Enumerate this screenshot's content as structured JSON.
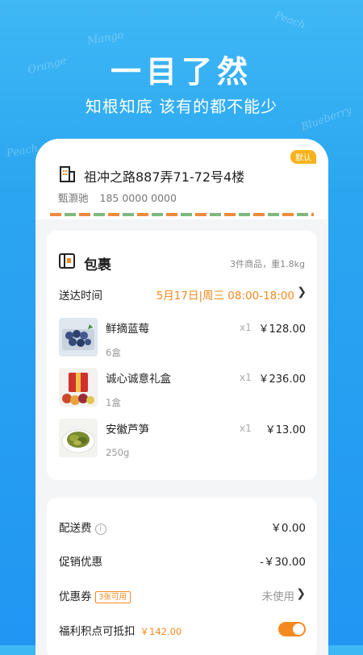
{
  "bg_words": [
    "Mango",
    "Peach",
    "Orange",
    "Blueberry",
    "Peach"
  ],
  "hero": {
    "title": "一目了然",
    "subtitle": "知根知底  该有的都不能少"
  },
  "address": {
    "badge": "默认",
    "line": "祖冲之路887弄71-72号4楼",
    "name": "甄灏驰",
    "phone": "185 0000 0000",
    "icon": "building-icon"
  },
  "package": {
    "title": "包裹",
    "summary": "3件商品，重1.8kg",
    "delivery_label": "送达时间",
    "delivery_time": "5月17日|周三 08:00-18:00",
    "items": [
      {
        "name": "鲜摘蓝莓",
        "spec": "6盒",
        "qty": "x1",
        "price": "￥128.00"
      },
      {
        "name": "诚心诚意礼盒",
        "spec": "1盒",
        "qty": "x1",
        "price": "￥236.00"
      },
      {
        "name": "安徽芦笋",
        "spec": "250g",
        "qty": "x1",
        "price": "￥13.00"
      }
    ]
  },
  "fees": {
    "shipping_label": "配送费",
    "shipping_value": "￥0.00",
    "promo_label": "促销优惠",
    "promo_value": "-￥30.00",
    "coupon_label": "优惠券",
    "coupon_tag": "3张可用",
    "coupon_value": "未使用",
    "points_label": "福利积点可抵扣",
    "points_value": "￥142.00"
  },
  "colors": {
    "accent": "#f5891f",
    "badge": "#f7b21c",
    "bg": "#2aa6f0"
  }
}
